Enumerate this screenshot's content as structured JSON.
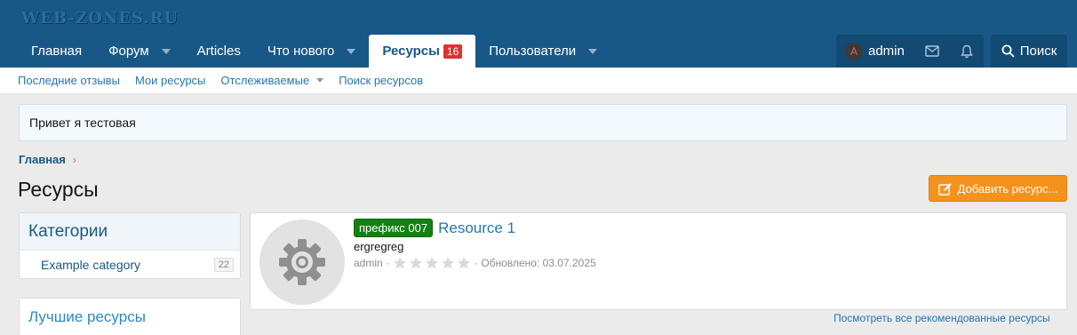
{
  "header": {
    "logo": "WEB-ZONES.RU",
    "nav": [
      {
        "label": "Главная",
        "caret": false
      },
      {
        "label": "Форум",
        "caret": true
      },
      {
        "label": "Articles",
        "caret": false
      },
      {
        "label": "Что нового",
        "caret": true
      },
      {
        "label": "Ресурсы",
        "badge": "16",
        "active": true
      },
      {
        "label": "Пользователи",
        "caret": true
      }
    ],
    "user": {
      "avatar_letter": "A",
      "name": "admin"
    },
    "icons": [
      "envelope-icon",
      "bell-icon"
    ],
    "search_label": "Поиск"
  },
  "subnav": [
    {
      "label": "Последние отзывы"
    },
    {
      "label": "Мои ресурсы"
    },
    {
      "label": "Отслеживаемые",
      "caret": true
    },
    {
      "label": "Поиск ресурсов"
    }
  ],
  "notice": "Привет я тестовая",
  "breadcrumb": {
    "item": "Главная"
  },
  "page": {
    "title": "Ресурсы",
    "add_button": "Добавить ресурс..."
  },
  "sidebar": {
    "categories_title": "Категории",
    "categories": [
      {
        "label": "Example category",
        "count": "22"
      }
    ],
    "best_title": "Лучшие ресурсы"
  },
  "resource": {
    "prefix": "префикс 007",
    "title": "Resource 1",
    "tagline": "ergregreg",
    "author": "admin",
    "rating": 0,
    "rating_max": 5,
    "updated": "· Обновлено: 03.07.2025"
  },
  "view_all": "Посмотреть все рекомендованные ресурсы",
  "colors": {
    "header": "#185886",
    "accent": "#2577b1",
    "button": "#f5921d",
    "prefix": "#138013",
    "badge": "#e03030"
  }
}
